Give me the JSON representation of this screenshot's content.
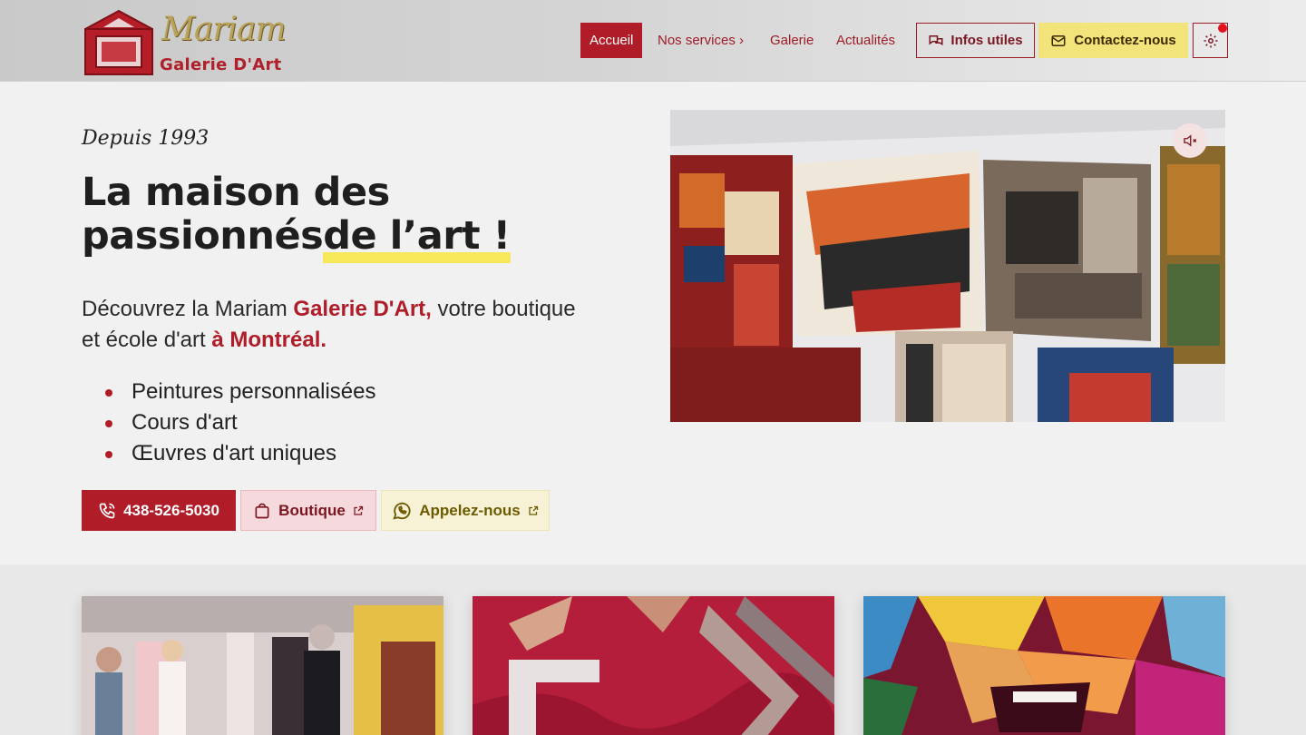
{
  "brand": {
    "name": "Mariam",
    "subtitle": "Galerie D'Art"
  },
  "nav": {
    "items": [
      {
        "label": "Accueil",
        "active": true
      },
      {
        "label": "Nos services ›",
        "active": false
      },
      {
        "label": "Galerie",
        "active": false
      },
      {
        "label": "Actualités",
        "active": false
      }
    ],
    "infos_label": "Infos utiles",
    "contact_label": "Contactez-nous",
    "settings_icon": "gear-icon"
  },
  "hero": {
    "since": "Depuis 1993",
    "title_line1": "La maison des",
    "title_line2_plain": "passionnés",
    "title_line2_highlight": " de l’art !",
    "desc_part1": "Découvrez la Mariam ",
    "desc_brand": "Galerie D'Art,",
    "desc_part2": " votre boutique et école d'art ",
    "desc_city": "à Montréal.",
    "features": [
      "Peintures personnalisées",
      "Cours d'art",
      "Œuvres d'art uniques"
    ],
    "phone_label": "438-526-5030",
    "shop_label": "Boutique",
    "call_label": "Appelez-nous"
  },
  "colors": {
    "accent_red": "#b01c28",
    "highlight_yellow": "#f7e85a",
    "contact_yellow": "#f2e37a"
  }
}
